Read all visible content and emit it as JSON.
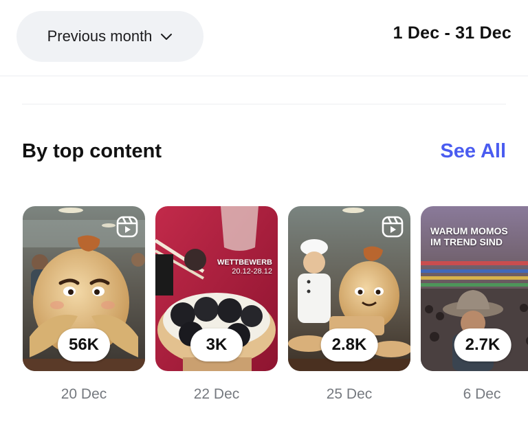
{
  "header": {
    "period_label": "Previous month",
    "date_range": "1 Dec - 31 Dec"
  },
  "section": {
    "title": "By top content",
    "see_all_label": "See All"
  },
  "cards": [
    {
      "metric": "56K",
      "date": "20 Dec",
      "reel_icon": "reels-icon"
    },
    {
      "metric": "3K",
      "date": "22 Dec",
      "overlay_line1": "WETTBEWERB",
      "overlay_line2": "20.12-28.12"
    },
    {
      "metric": "2.8K",
      "date": "25 Dec",
      "reel_icon": "reels-icon"
    },
    {
      "metric": "2.7K",
      "date": "6 Dec",
      "overlay_line1": "WARUM MOMOS",
      "overlay_line2": "IM TREND SIND"
    }
  ],
  "colors": {
    "accent": "#4a5cf0",
    "pill_bg": "#f0f2f5",
    "muted_text": "#75797f"
  }
}
